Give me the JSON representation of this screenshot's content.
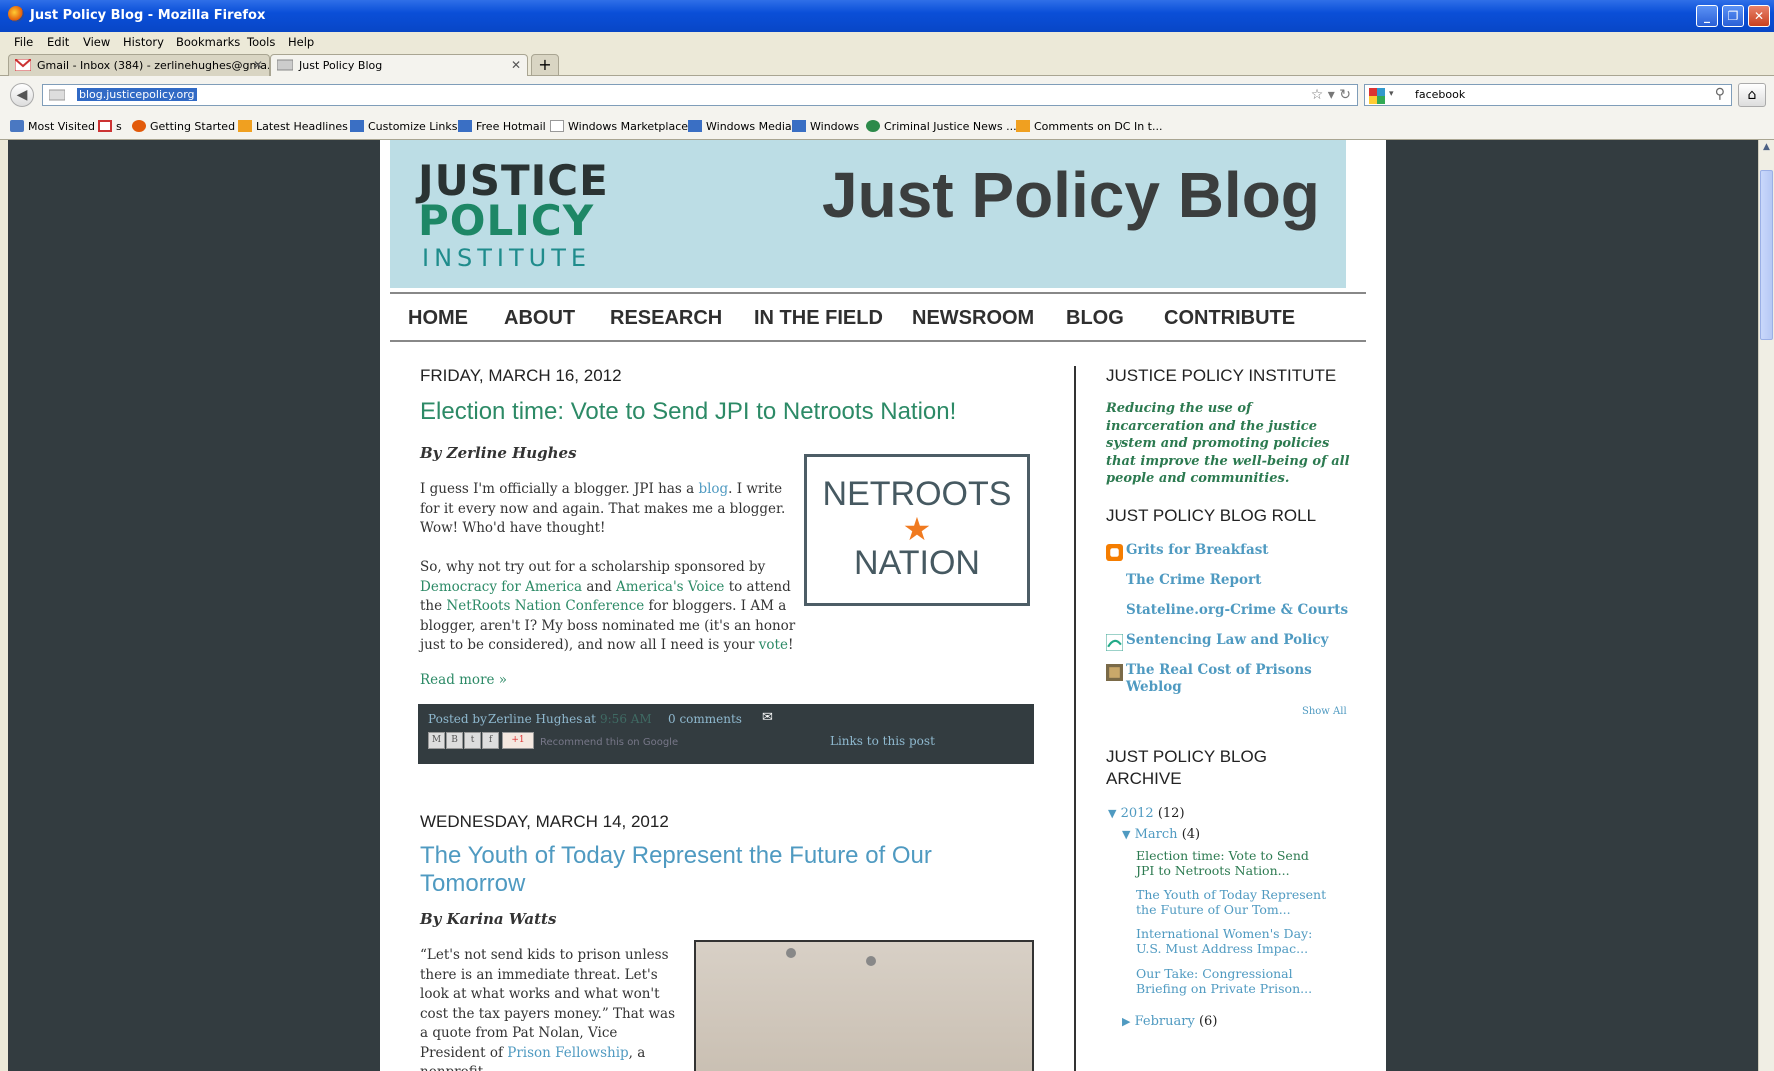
{
  "window": {
    "title": "Just Policy Blog - Mozilla Firefox"
  },
  "menu": [
    "File",
    "Edit",
    "View",
    "History",
    "Bookmarks",
    "Tools",
    "Help"
  ],
  "tabs": [
    {
      "label": "Gmail - Inbox (384) - zerlinehughes@gma..."
    },
    {
      "label": "Just Policy Blog"
    }
  ],
  "nav": {
    "url": "blog.justicepolicy.org",
    "search": "facebook"
  },
  "bookmarks": [
    "Most Visited",
    "s",
    "Getting Started",
    "Latest Headlines",
    "Customize Links",
    "Free Hotmail",
    "Windows Marketplace",
    "Windows Media",
    "Windows",
    "Criminal Justice News ...",
    "Comments on DC In t..."
  ],
  "site": {
    "logo": {
      "line1": "JUSTICE",
      "line2": "POLICY",
      "line3": "INSTITUTE"
    },
    "blog_title": "Just Policy Blog",
    "nav": [
      "HOME",
      "ABOUT",
      "RESEARCH",
      "IN THE FIELD",
      "NEWSROOM",
      "BLOG",
      "CONTRIBUTE"
    ]
  },
  "post1": {
    "date": "FRIDAY, MARCH 16, 2012",
    "title": "Election time: Vote to Send JPI to Netroots Nation!",
    "byline": "By Zerline Hughes",
    "p1a": "I guess I'm officially a blogger. JPI has a ",
    "p1link": "blog",
    "p1b": ". I write for it every now and again. That makes me a blogger. Wow! Who'd have thought!",
    "p2a": "So, why not try out for a scholarship sponsored by ",
    "p2l1": "Democracy for America",
    "p2b": " and ",
    "p2l2": "America's Voice",
    "p2c": " to attend the ",
    "p2l3": "NetRoots Nation Conference",
    "p2d": " for bloggers. I AM a blogger, aren't I? My boss nominated me (it's an honor just to be considered), and now all I need is your ",
    "p2l4": "vote",
    "p2e": "!",
    "readmore": "Read more »",
    "image": {
      "line1": "NETROOTS",
      "star": "★",
      "line2": "NATION"
    },
    "footer": {
      "posted_by": "Posted by",
      "author": "Zerline Hughes",
      "at": "at",
      "time": "9:56 AM",
      "comments": "0 comments",
      "recommend": "Recommend this on Google",
      "links": "Links to this post",
      "gplus": "+1"
    }
  },
  "post2": {
    "date": "WEDNESDAY, MARCH 14, 2012",
    "title_l1": "The Youth of Today Represent the Future of Our",
    "title_l2": "Tomorrow",
    "byline": "By Karina Watts",
    "body": "“Let's not send kids to prison unless there is an immediate threat. Let's look at what works and what won't cost the tax payers money.” That was a quote from Pat Nolan, Vice President of",
    "link": "Prison Fellowship",
    "tail": ", a nonprofit"
  },
  "sidebar": {
    "jpi_head": "JUSTICE POLICY INSTITUTE",
    "jpi_text": "Reducing the use of incarceration and the justice system and promoting policies that improve the well-being of all people and communities.",
    "roll_head": "JUST POLICY BLOG ROLL",
    "roll": [
      "Grits for Breakfast",
      "The Crime Report",
      "Stateline.org-Crime & Courts",
      "Sentencing Law and Policy",
      "The Real Cost of Prisons Weblog"
    ],
    "show_all": "Show All",
    "archive_head_l1": "JUST POLICY BLOG",
    "archive_head_l2": "ARCHIVE",
    "year": "2012",
    "year_count": "(12)",
    "month": "March",
    "month_count": "(4)",
    "posts": [
      "Election time: Vote to Send JPI to Netroots Nation...",
      "The Youth of Today Represent the Future of Our Tom...",
      "International Women's Day: U.S. Must Address Impac...",
      "Our Take: Congressional Briefing on Private Prison..."
    ],
    "month2": "February",
    "month2_count": "(6)"
  },
  "colors": {
    "accent": "#2c8a66",
    "link": "#4f9ac1",
    "banner": "#bcdde5",
    "page_bg": "#333c40"
  }
}
